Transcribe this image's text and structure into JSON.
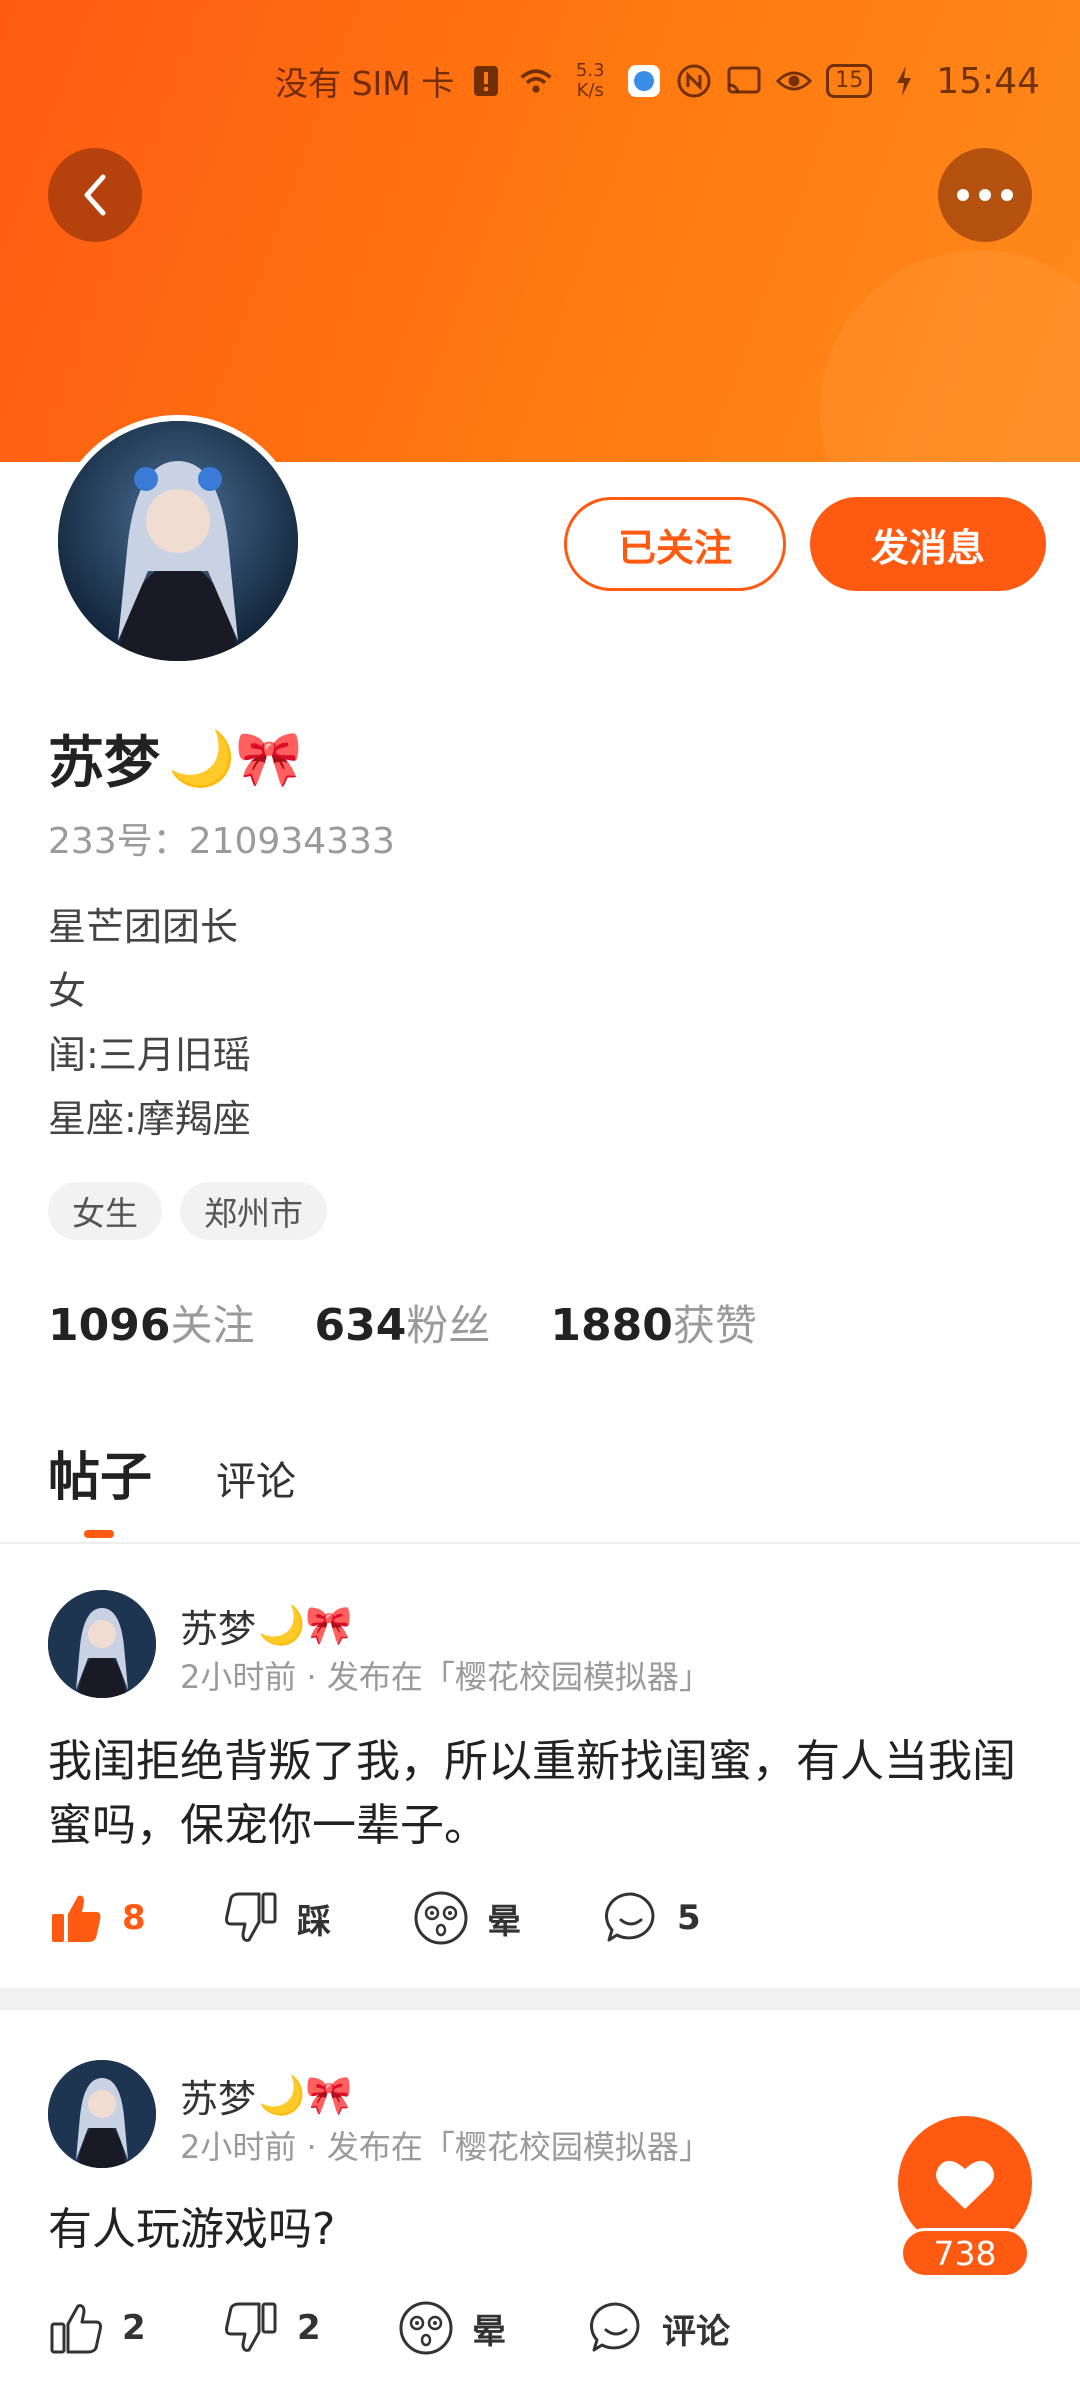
{
  "status_bar": {
    "carrier": "没有 SIM 卡",
    "net_speed_value": "5.3",
    "net_speed_unit": "K/s",
    "battery": "15",
    "time": "15:44"
  },
  "profile": {
    "name": "苏梦",
    "name_emoji": "🌙🎀",
    "uid": "233号：210934333",
    "bio": [
      "星芒团团长",
      "女",
      "闺:三月旧瑶",
      "星座:摩羯座"
    ],
    "tags": [
      "女生",
      "郑州市"
    ],
    "stats": [
      {
        "num": "1096",
        "label": "关注"
      },
      {
        "num": "634",
        "label": "粉丝"
      },
      {
        "num": "1880",
        "label": "获赞"
      }
    ],
    "follow_label": "已关注",
    "message_label": "发消息"
  },
  "tabs": [
    {
      "label": "帖子",
      "active": true
    },
    {
      "label": "评论",
      "active": false
    }
  ],
  "posts": [
    {
      "author": "苏梦",
      "author_emoji": "🌙🎀",
      "meta": "2小时前 · 发布在「樱花校园模拟器」",
      "text": "我闺拒绝背叛了我，所以重新找闺蜜，有人当我闺蜜吗，保宠你一辈子。",
      "likes": "8",
      "dislike_label": "踩",
      "dizzy_label": "晕",
      "comments": "5"
    },
    {
      "author": "苏梦",
      "author_emoji": "🌙🎀",
      "meta": "2小时前 · 发布在「樱花校园模拟器」",
      "text": "有人玩游戏吗?",
      "likes": "2",
      "dislike_label": "2",
      "dizzy_label": "晕",
      "comments": "评论"
    }
  ],
  "fab": {
    "count": "738"
  },
  "colors": {
    "accent": "#ff5a12",
    "banner": "#ff7a10"
  }
}
